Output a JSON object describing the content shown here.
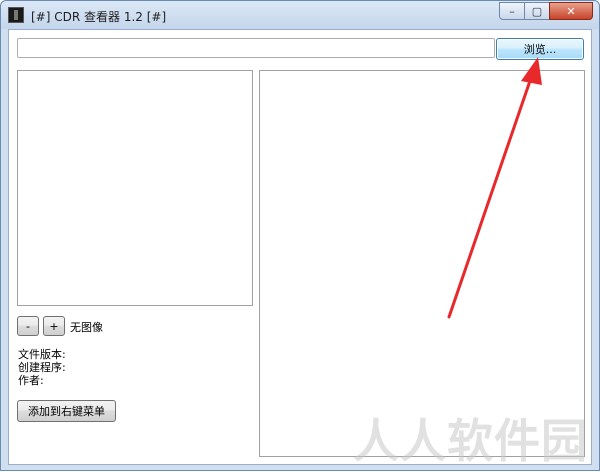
{
  "window": {
    "title": "[#] CDR 查看器 1.2 [#]",
    "minimize_glyph": "–",
    "maximize_glyph": "▢",
    "close_glyph": "✕"
  },
  "file": {
    "path_value": "",
    "browse_label": "浏览..."
  },
  "zoom": {
    "minus_label": "-",
    "plus_label": "+",
    "status": "无图像"
  },
  "info": {
    "version_label": "文件版本:",
    "creator_label": "创建程序:",
    "author_label": "作者:"
  },
  "actions": {
    "context_menu_label": "添加到右键菜单"
  },
  "annotation": {
    "arrow_color": "#e8292b"
  },
  "watermark": {
    "text": "人人软件园"
  }
}
